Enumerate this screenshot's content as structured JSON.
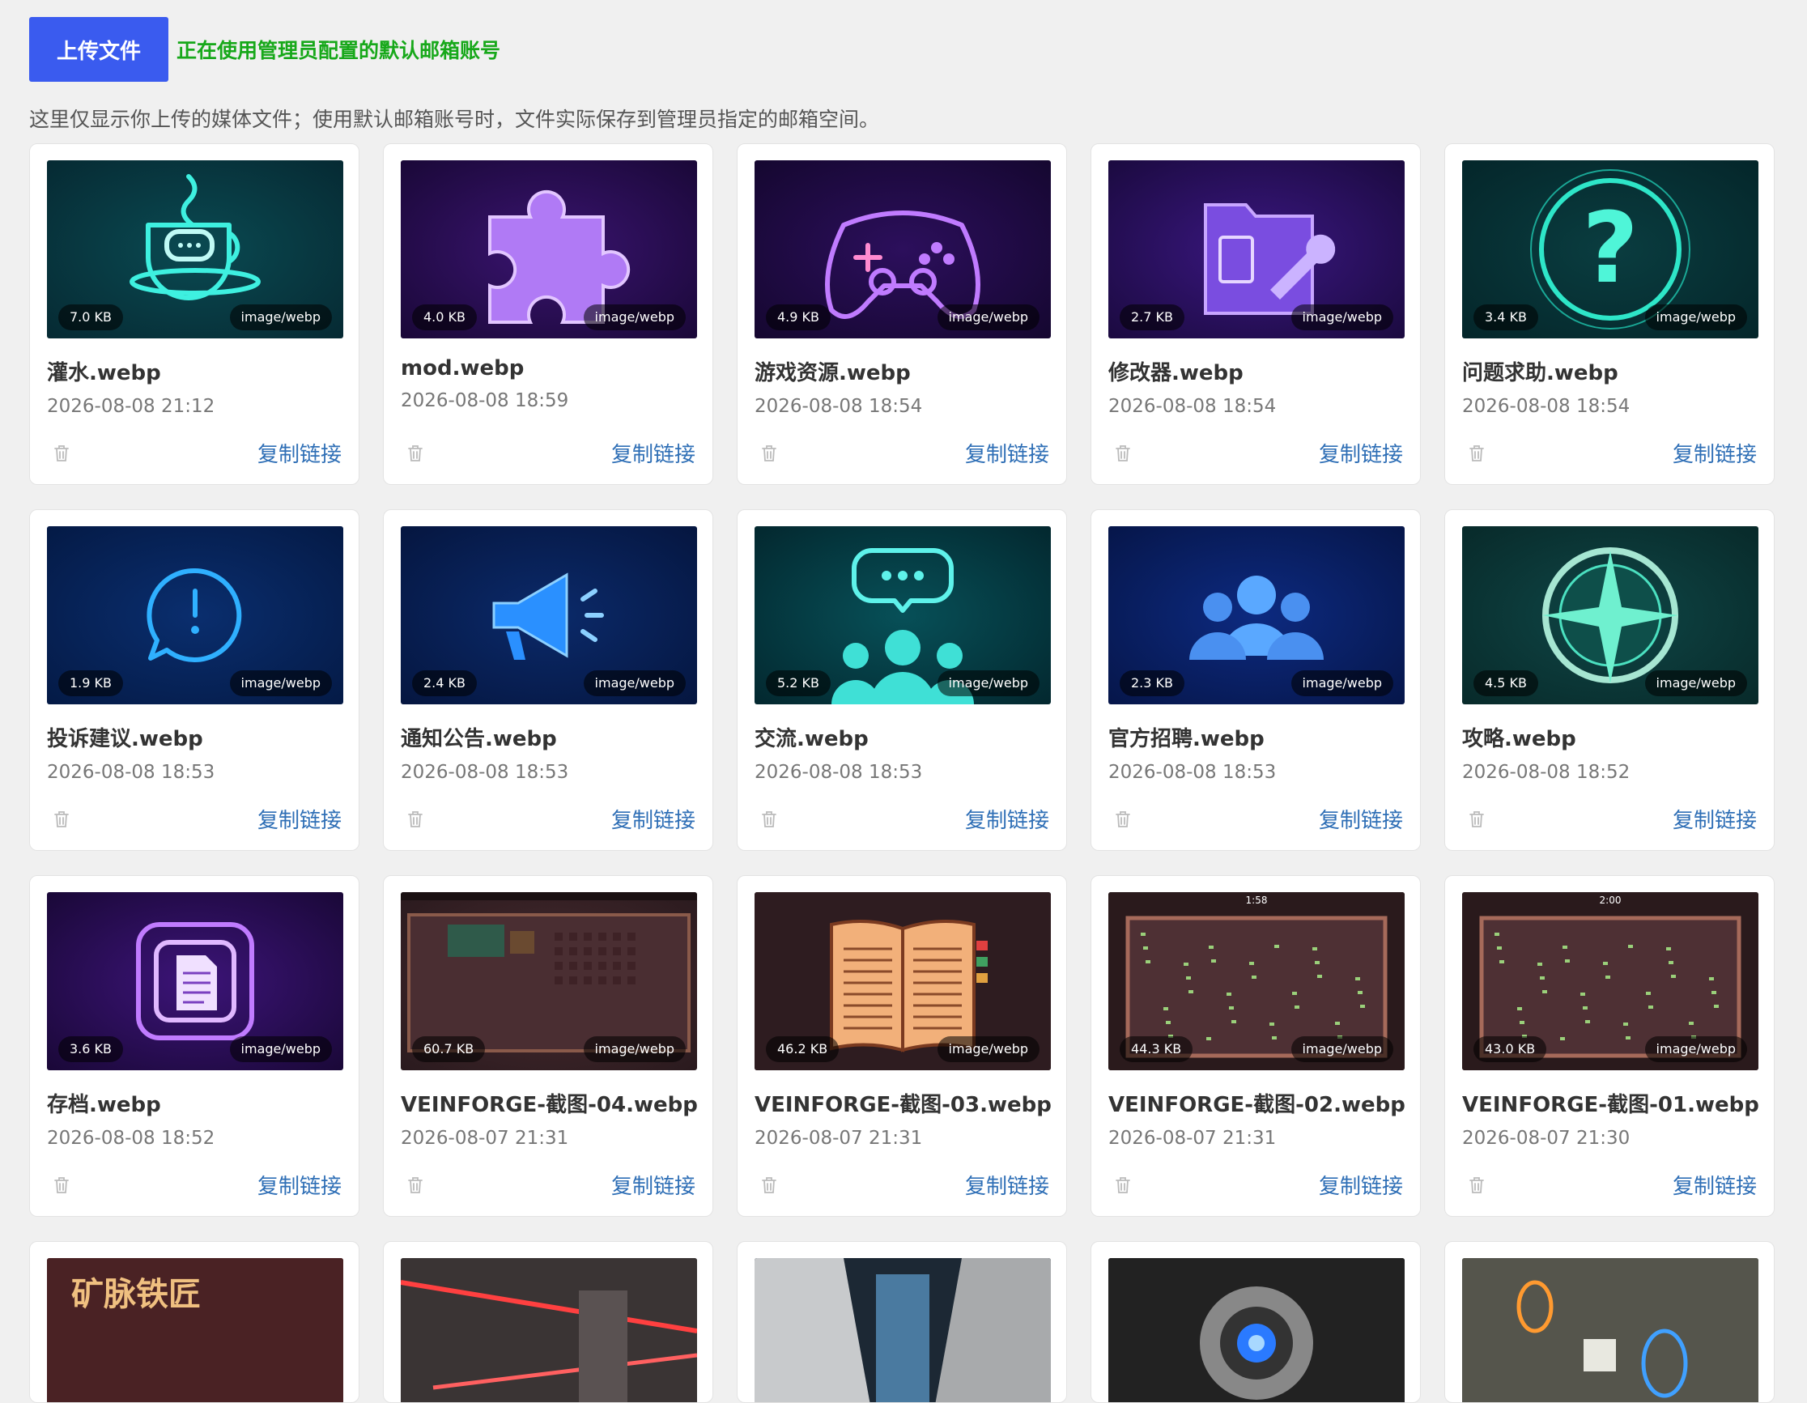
{
  "header": {
    "upload_label": "上传文件",
    "account_note": "正在使用管理员配置的默认邮箱账号",
    "hint": "这里仅显示你上传的媒体文件；使用默认邮箱账号时，文件实际保存到管理员指定的邮箱空间。"
  },
  "colors": {
    "accent": "#3a5bef",
    "success": "#17a81a",
    "link": "#2f6fb6"
  },
  "files": [
    {
      "name": "灌水.webp",
      "date": "2026-08-08 21:12",
      "size": "7.0 KB",
      "mime": "image/webp",
      "icon": "coffee-cup-chat-icon",
      "copy": "复制链接"
    },
    {
      "name": "mod.webp",
      "date": "2026-08-08 18:59",
      "size": "4.0 KB",
      "mime": "image/webp",
      "icon": "puzzle-piece-icon",
      "copy": "复制链接"
    },
    {
      "name": "游戏资源.webp",
      "date": "2026-08-08 18:54",
      "size": "4.9 KB",
      "mime": "image/webp",
      "icon": "gamepad-icon",
      "copy": "复制链接"
    },
    {
      "name": "修改器.webp",
      "date": "2026-08-08 18:54",
      "size": "2.7 KB",
      "mime": "image/webp",
      "icon": "folder-wrench-icon",
      "copy": "复制链接"
    },
    {
      "name": "问题求助.webp",
      "date": "2026-08-08 18:54",
      "size": "3.4 KB",
      "mime": "image/webp",
      "icon": "question-mark-icon",
      "copy": "复制链接"
    },
    {
      "name": "投诉建议.webp",
      "date": "2026-08-08 18:53",
      "size": "1.9 KB",
      "mime": "image/webp",
      "icon": "exclamation-bubble-icon",
      "copy": "复制链接"
    },
    {
      "name": "通知公告.webp",
      "date": "2026-08-08 18:53",
      "size": "2.4 KB",
      "mime": "image/webp",
      "icon": "megaphone-icon",
      "copy": "复制链接"
    },
    {
      "name": "交流.webp",
      "date": "2026-08-08 18:53",
      "size": "5.2 KB",
      "mime": "image/webp",
      "icon": "group-chat-icon",
      "copy": "复制链接"
    },
    {
      "name": "官方招聘.webp",
      "date": "2026-08-08 18:53",
      "size": "2.3 KB",
      "mime": "image/webp",
      "icon": "people-group-icon",
      "copy": "复制链接"
    },
    {
      "name": "攻略.webp",
      "date": "2026-08-08 18:52",
      "size": "4.5 KB",
      "mime": "image/webp",
      "icon": "compass-icon",
      "copy": "复制链接"
    },
    {
      "name": "存档.webp",
      "date": "2026-08-08 18:52",
      "size": "3.6 KB",
      "mime": "image/webp",
      "icon": "document-icon",
      "copy": "复制链接"
    },
    {
      "name": "VEINFORGE-截图-04.webp",
      "date": "2026-08-07 21:31",
      "size": "60.7 KB",
      "mime": "image/webp",
      "icon": "game-screenshot-icon",
      "copy": "复制链接"
    },
    {
      "name": "VEINFORGE-截图-03.webp",
      "date": "2026-08-07 21:31",
      "size": "46.2 KB",
      "mime": "image/webp",
      "icon": "open-book-screenshot-icon",
      "copy": "复制链接"
    },
    {
      "name": "VEINFORGE-截图-02.webp",
      "date": "2026-08-07 21:31",
      "size": "44.3 KB",
      "mime": "image/webp",
      "icon": "arena-screenshot-icon",
      "copy": "复制链接",
      "timer": "1:58"
    },
    {
      "name": "VEINFORGE-截图-01.webp",
      "date": "2026-08-07 21:30",
      "size": "43.0 KB",
      "mime": "image/webp",
      "icon": "arena-screenshot-icon",
      "copy": "复制链接",
      "timer": "2:00"
    }
  ],
  "partial_row": [
    {
      "icon": "title-banner-icon",
      "caption": "矿脉铁匠"
    },
    {
      "icon": "laser-room-icon"
    },
    {
      "icon": "corridor-icon"
    },
    {
      "icon": "robot-eye-icon"
    },
    {
      "icon": "test-chamber-icon"
    }
  ]
}
